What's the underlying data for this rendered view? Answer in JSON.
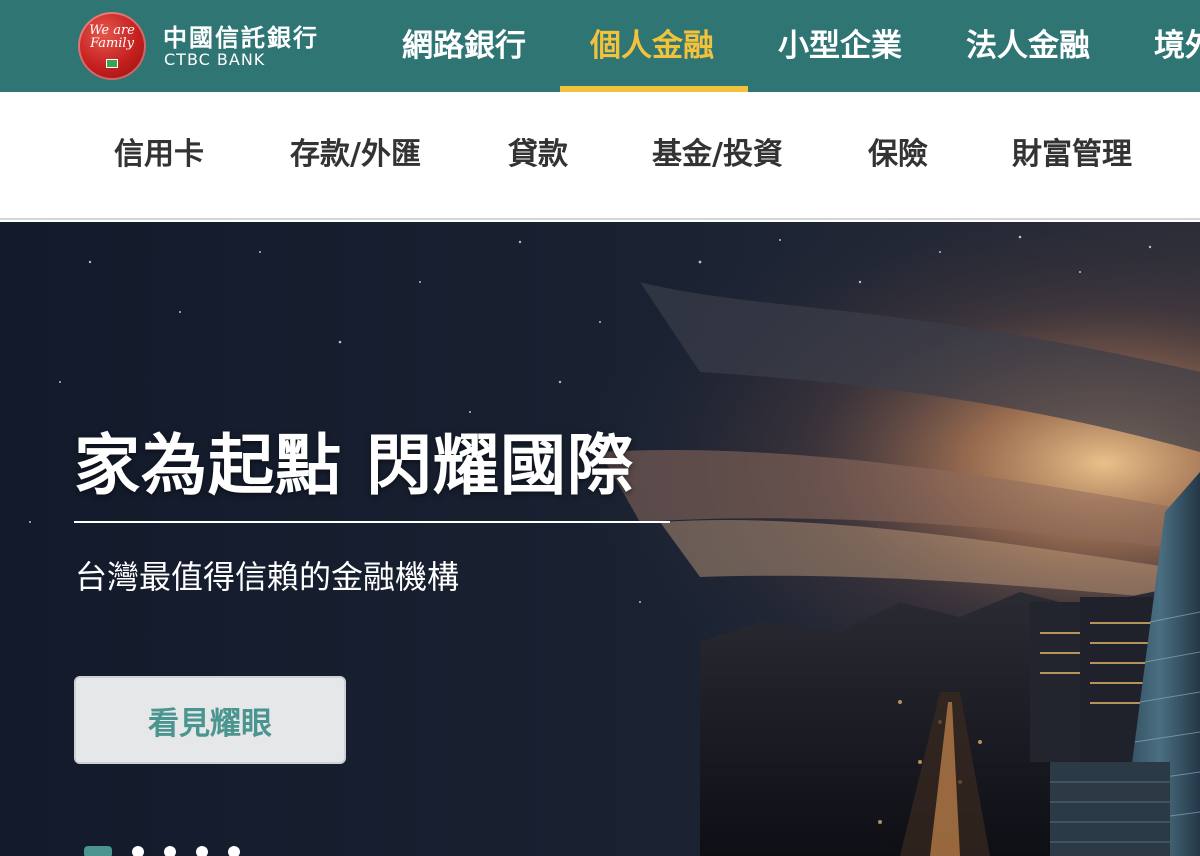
{
  "brand": {
    "logo_script": "We are Family",
    "name_cn": "中國信託銀行",
    "name_en": "CTBC BANK"
  },
  "main_nav": {
    "items": [
      "網路銀行",
      "個人金融",
      "小型企業",
      "法人金融",
      "境外"
    ],
    "active_index": 1
  },
  "sub_nav": {
    "items": [
      "信用卡",
      "存款/外匯",
      "貸款",
      "基金/投資",
      "保險",
      "財富管理"
    ]
  },
  "hero": {
    "title": "家為起點 閃耀國際",
    "subtitle": "台灣最值得信賴的金融機構",
    "cta_label": "看見耀眼",
    "slides_count": 5,
    "active_slide": 0
  },
  "colors": {
    "brand_teal": "#2e7574",
    "accent_yellow": "#f2c23c",
    "cta_text": "#4a958f",
    "logo_red": "#c41f1f"
  }
}
